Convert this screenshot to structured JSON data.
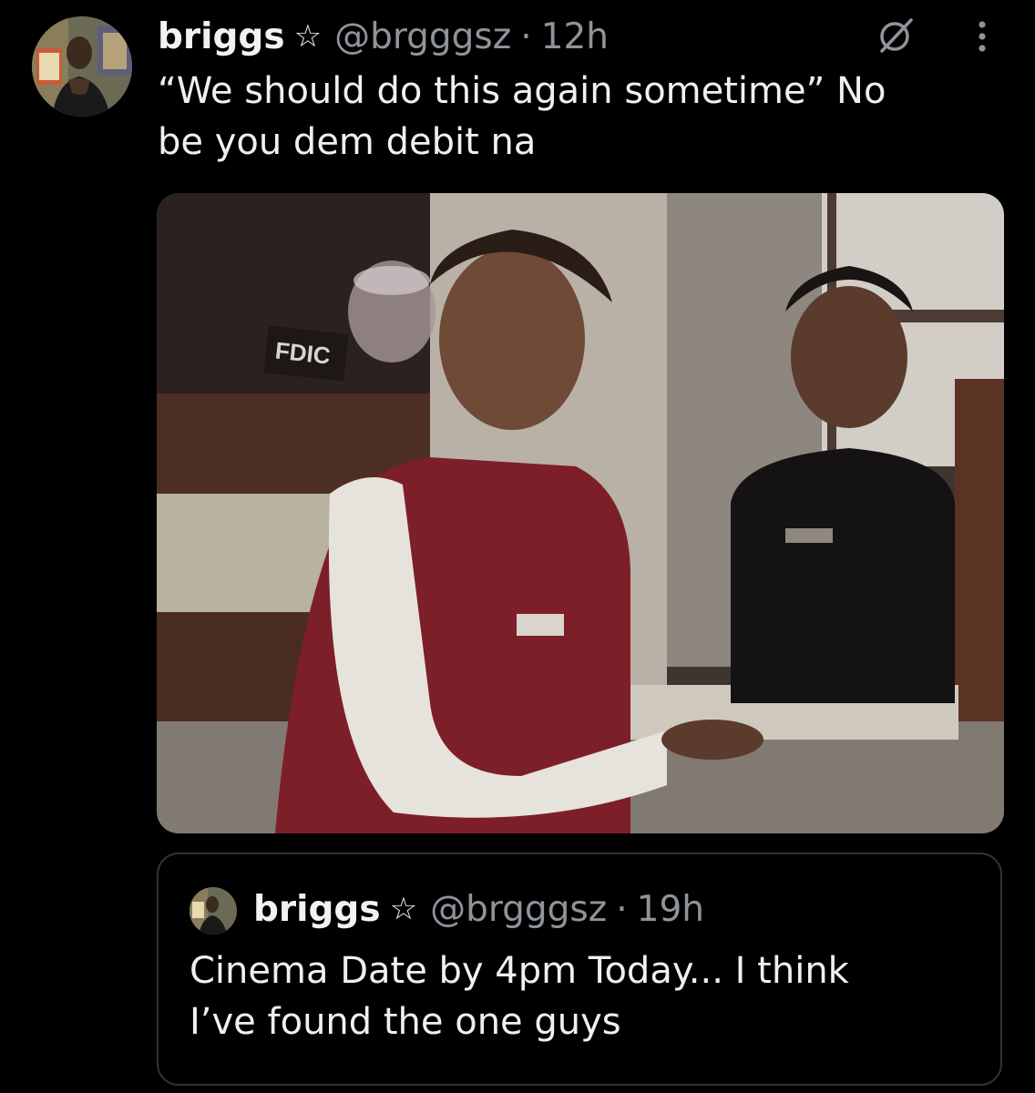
{
  "tweet": {
    "author_name": "briggs",
    "author_handle": "@brgggsz",
    "separator": "·",
    "time": "12h",
    "text_line1": "“We should do this again sometime” No",
    "text_line2": "be you dem debit na",
    "badge_icon": "star-outline-icon",
    "grok_icon": "grok-icon",
    "more_icon": "more-options-icon",
    "media_sign_text": "FDIC"
  },
  "quoted_tweet": {
    "author_name": "briggs",
    "author_handle": "@brgggsz",
    "separator": "·",
    "time": "19h",
    "text_line1": "Cinema Date by 4pm Today... I think",
    "text_line2": "I’ve found the one guys",
    "badge_icon": "star-outline-icon"
  },
  "colors": {
    "background": "#000000",
    "text": "#e7e9ea",
    "secondary_text": "#8f949a",
    "border": "#2f3336"
  }
}
